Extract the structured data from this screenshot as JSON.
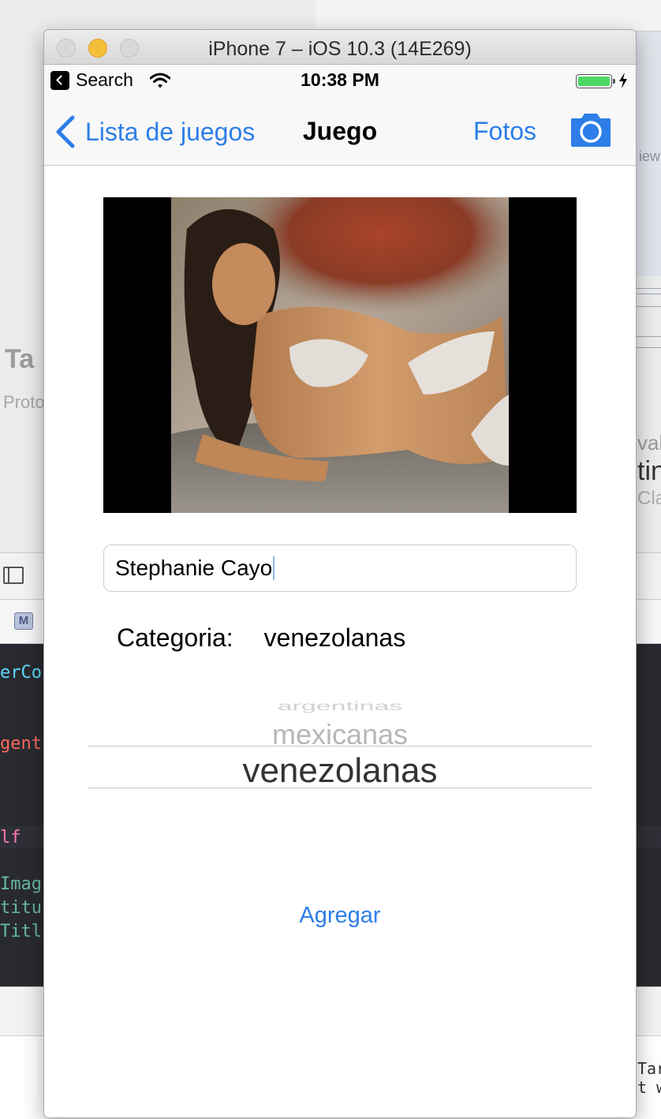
{
  "simulator": {
    "window_title": "iPhone 7 – iOS 10.3 (14E269)"
  },
  "status_bar": {
    "back_app_label": "Search",
    "time": "10:38 PM",
    "battery_level": 1.0
  },
  "nav_bar": {
    "back_label": "Lista de juegos",
    "title": "Juego",
    "fotos_label": "Fotos",
    "camera_icon": "camera-icon"
  },
  "form": {
    "name_value": "Stephanie Cayo",
    "category_label": "Categoria:",
    "category_value": "venezolanas"
  },
  "picker": {
    "options_visible": [
      "argentinas",
      "mexicanas",
      "venezolanas"
    ],
    "selected": "venezolanas"
  },
  "actions": {
    "add_label": "Agregar"
  },
  "xcode_background": {
    "left_title_fragment": "Ta",
    "left_sub_fragment": "Proto",
    "right_frag_1": "iew",
    "right_frag_2": "val",
    "right_frag_3": "tin",
    "right_frag_4": "Cla",
    "badge_m": "M",
    "code_lines": [
      "erCon",
      "gent",
      "lf",
      "Imag",
      "titu",
      "Titl"
    ],
    "console_lines": [
      "Tarc",
      "t w"
    ]
  },
  "colors": {
    "ios_tint": "#2d7ee8",
    "battery_green": "#4cd964",
    "minimize_yellow": "#f6bf3a"
  }
}
